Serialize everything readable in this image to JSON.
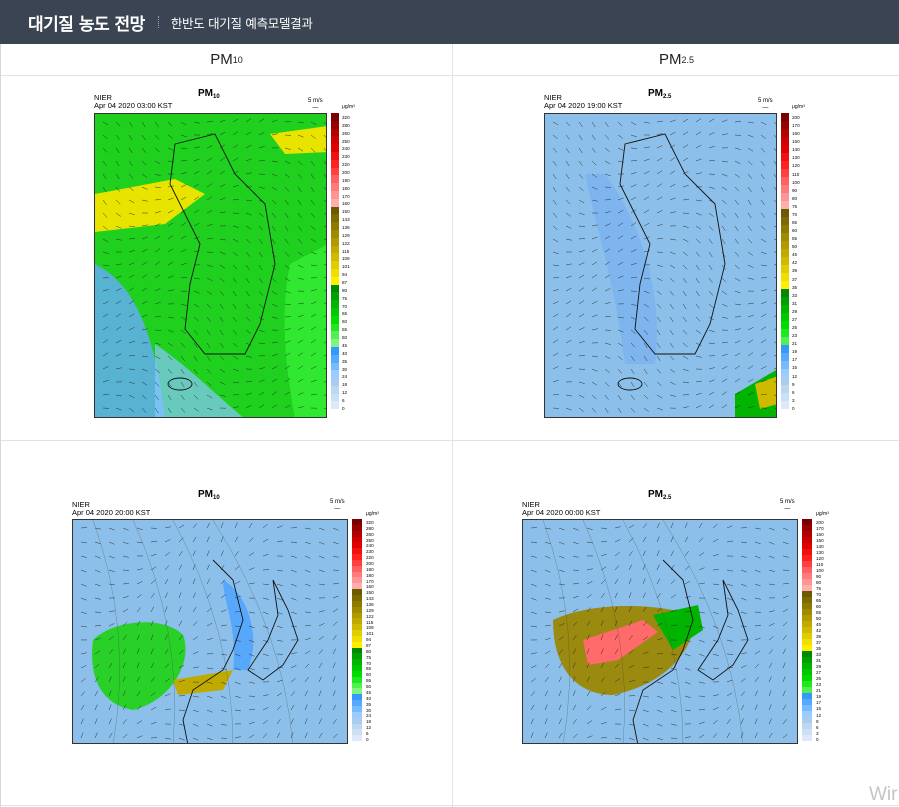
{
  "header": {
    "title": "대기질 농도 전망",
    "subtitle": "한반도 대기질 예측모델결과"
  },
  "columns": [
    {
      "base": "PM",
      "sub": "10"
    },
    {
      "base": "PM",
      "sub": "2.5"
    }
  ],
  "panels": [
    {
      "id": "p1",
      "kind": "pm10",
      "region": "korea",
      "title_base": "PM",
      "title_sub": "10",
      "source": "NIER",
      "timestamp": "Apr 04 2020 03:00 KST",
      "wind_scale": "5 m/s",
      "unit": "μg/m³",
      "legend": [
        "320",
        "280",
        "260",
        "250",
        "240",
        "230",
        "220",
        "200",
        "190",
        "180",
        "170",
        "160",
        "150",
        "143",
        "136",
        "129",
        "122",
        "115",
        "108",
        "101",
        "94",
        "87",
        "80",
        "75",
        "70",
        "65",
        "60",
        "55",
        "50",
        "45",
        "40",
        "35",
        "30",
        "24",
        "18",
        "12",
        "6",
        "0"
      ]
    },
    {
      "id": "p2",
      "kind": "pm25",
      "region": "korea",
      "title_base": "PM",
      "title_sub": "2.5",
      "source": "NIER",
      "timestamp": "Apr 04 2020 19:00 KST",
      "wind_scale": "5 m/s",
      "unit": "μg/m³",
      "legend": [
        "200",
        "170",
        "160",
        "150",
        "140",
        "130",
        "120",
        "110",
        "100",
        "90",
        "80",
        "75",
        "70",
        "65",
        "60",
        "55",
        "50",
        "45",
        "42",
        "39",
        "37",
        "35",
        "33",
        "31",
        "29",
        "27",
        "25",
        "23",
        "21",
        "19",
        "17",
        "15",
        "12",
        "9",
        "6",
        "3",
        "0"
      ]
    },
    {
      "id": "p3",
      "kind": "pm10",
      "region": "east-asia",
      "title_base": "PM",
      "title_sub": "10",
      "source": "NIER",
      "timestamp": "Apr 04 2020 20:00 KST",
      "wind_scale": "5 m/s",
      "unit": "μg/m³",
      "legend": [
        "320",
        "280",
        "260",
        "250",
        "240",
        "230",
        "220",
        "200",
        "190",
        "180",
        "170",
        "160",
        "150",
        "143",
        "136",
        "129",
        "122",
        "115",
        "108",
        "101",
        "94",
        "87",
        "80",
        "75",
        "70",
        "65",
        "60",
        "55",
        "50",
        "45",
        "40",
        "35",
        "30",
        "24",
        "18",
        "12",
        "6",
        "0"
      ]
    },
    {
      "id": "p4",
      "kind": "pm25",
      "region": "east-asia",
      "title_base": "PM",
      "title_sub": "2.5",
      "source": "NIER",
      "timestamp": "Apr 04 2020 00:00 KST",
      "wind_scale": "5 m/s",
      "unit": "μg/m³",
      "legend": [
        "200",
        "170",
        "160",
        "150",
        "140",
        "130",
        "120",
        "110",
        "100",
        "90",
        "80",
        "75",
        "70",
        "65",
        "60",
        "55",
        "50",
        "45",
        "42",
        "39",
        "37",
        "35",
        "33",
        "31",
        "29",
        "27",
        "25",
        "23",
        "21",
        "19",
        "17",
        "15",
        "12",
        "9",
        "6",
        "3",
        "0"
      ]
    }
  ],
  "colors": {
    "header_bg": "#3a4452",
    "pm10_scale": [
      "#7a0000",
      "#990000",
      "#b30000",
      "#cc0000",
      "#e00000",
      "#f01010",
      "#ff2020",
      "#ff4040",
      "#ff6060",
      "#ff7a7a",
      "#ff9494",
      "#ffadad",
      "#6b5a00",
      "#7d6a00",
      "#8f7a00",
      "#a08a00",
      "#b09a00",
      "#c0aa00",
      "#d0ba00",
      "#e0cc00",
      "#f0de00",
      "#ffee00",
      "#008800",
      "#00a000",
      "#00b400",
      "#00c800",
      "#00dc00",
      "#20e820",
      "#50f050",
      "#80f480",
      "#3399ff",
      "#55aaff",
      "#77bbff",
      "#99ccff",
      "#aaccee",
      "#bbd8f0",
      "#cce0f5",
      "#dde8f8"
    ],
    "pm25_scale": [
      "#7a0000",
      "#990000",
      "#b30000",
      "#cc0000",
      "#e00000",
      "#f01010",
      "#ff2020",
      "#ff4040",
      "#ff6060",
      "#ff7a7a",
      "#ff9494",
      "#ffadad",
      "#6b5a00",
      "#7d6a00",
      "#8f7a00",
      "#a08a00",
      "#b09a00",
      "#c0aa00",
      "#d0ba00",
      "#e0cc00",
      "#f0de00",
      "#ffee00",
      "#008800",
      "#00a000",
      "#00b400",
      "#00c800",
      "#00dc00",
      "#20e820",
      "#50f050",
      "#3399ff",
      "#55aaff",
      "#77bbff",
      "#99ccff",
      "#aaccee",
      "#bbd8f0",
      "#cce0f5",
      "#dde8f8"
    ]
  },
  "watermark": "Wir"
}
